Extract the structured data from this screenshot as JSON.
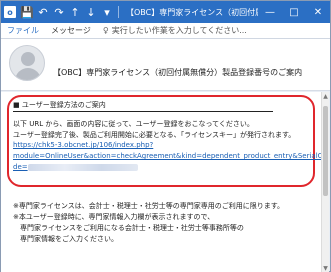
{
  "titlebar": {
    "app_badge": "o",
    "save_icon": "💾",
    "undo_icon": "↶",
    "redo_icon": "↷",
    "up_icon": "↑",
    "down_icon": "↓",
    "more_icon": "▾",
    "title": "【OBC】専門家ライセンス（初回付属無償分）製品登録番号のご案内",
    "min": "—",
    "max": "□",
    "close": "✕"
  },
  "ribbon": {
    "file": "ファイル",
    "message": "メッセージ",
    "tell_icon": "♀",
    "tell_text": "実行したい作業を入力してください..."
  },
  "header": {
    "subject": "【OBC】専門家ライセンス（初回付属無償分）製品登録番号のご案内"
  },
  "content": {
    "heading": "■ ユーザー登録方法のご案内",
    "line1": "以下 URL から、画面の内容に従って、ユーザー登録をおこなってください。",
    "line2": "ユーザー登録完了後、製品ご利用開始に必要となる、「ライセンスキー」が発行されます。",
    "link1": "https://chk5-3.obcnet.jp/106/index.php?",
    "link2": "module=OnlineUser&action=checkAgreement&kind=dependent_product_entry&SerialCo",
    "link3": "de=",
    "note1": "※専門家ライセンスは、会計士・税理士・社労士等の専門家専用のご利用に限ります。",
    "note2": "※本ユーザー登録時に、専門家情報入力欄が表示されますので、",
    "note3": "　専門家ライセンスをご利用になる会計士・税理士・社労士等事務所等の",
    "note4": "　専門家情報をご入力ください。"
  },
  "colors": {
    "titlebar": "#2b6fc4",
    "highlight": "#e0262c",
    "link": "#1a5fb4"
  }
}
